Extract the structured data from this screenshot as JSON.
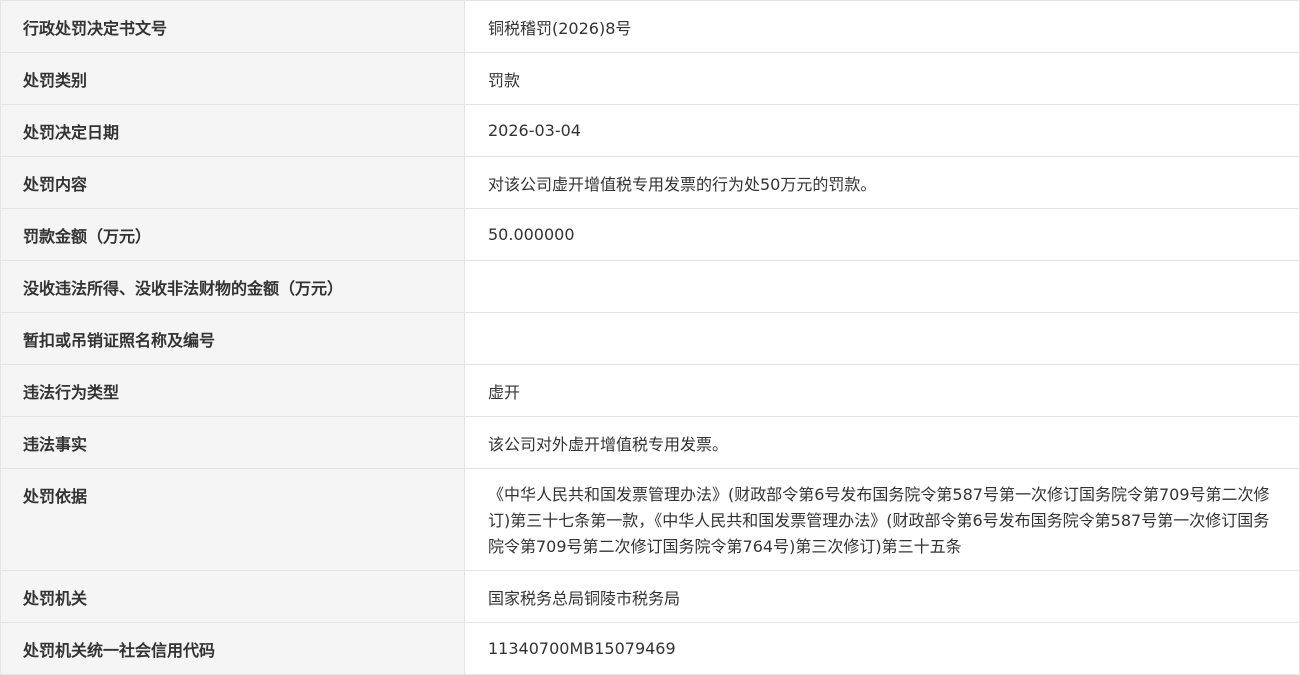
{
  "rows": [
    {
      "label": "行政处罚决定书文号",
      "value": "铜税稽罚(2026)8号"
    },
    {
      "label": "处罚类别",
      "value": "罚款"
    },
    {
      "label": "处罚决定日期",
      "value": "2026-03-04"
    },
    {
      "label": "处罚内容",
      "value": "对该公司虚开增值税专用发票的行为处50万元的罚款。"
    },
    {
      "label": "罚款金额（万元）",
      "value": "50.000000"
    },
    {
      "label": "没收违法所得、没收非法财物的金额（万元）",
      "value": ""
    },
    {
      "label": "暂扣或吊销证照名称及编号",
      "value": ""
    },
    {
      "label": "违法行为类型",
      "value": "虚开"
    },
    {
      "label": "违法事实",
      "value": "该公司对外虚开增值税专用发票。"
    },
    {
      "label": "处罚依据",
      "value": "《中华人民共和国发票管理办法》(财政部令第6号发布国务院令第587号第一次修订国务院令第709号第二次修订)第三十七条第一款，《中华人民共和国发票管理办法》(财政部令第6号发布国务院令第587号第一次修订国务院令第709号第二次修订国务院令第764号)第三次修订)第三十五条"
    },
    {
      "label": "处罚机关",
      "value": "国家税务总局铜陵市税务局"
    },
    {
      "label": "处罚机关统一社会信用代码",
      "value": "11340700MB15079469"
    }
  ]
}
